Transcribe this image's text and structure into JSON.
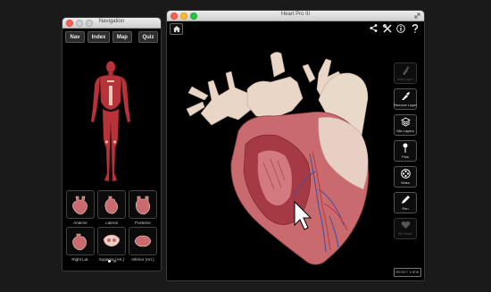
{
  "nav_window": {
    "title": "Navigation",
    "tabs": [
      "Nav",
      "Index",
      "Map",
      "Quiz"
    ],
    "thumbnails": [
      "Anterior",
      "Lateral",
      "Posterior",
      "Right Lat.",
      "Superior (Art.)",
      "Inferior (Art.)"
    ],
    "page_dots": 2
  },
  "main_window": {
    "title": "Heart Pro III",
    "toolbar_icons": [
      "home-icon",
      "share-icon",
      "tools-icon",
      "info-icon",
      "help-icon"
    ],
    "right_tools": [
      {
        "label": "Add Layer",
        "icon": "add-layer-icon",
        "enabled": false
      },
      {
        "label": "Remove Layer",
        "icon": "remove-layer-icon",
        "enabled": true
      },
      {
        "label": "Mix Layers",
        "icon": "layers-icon",
        "enabled": true
      },
      {
        "label": "Pins",
        "icon": "pin-icon",
        "enabled": true
      },
      {
        "label": "Video",
        "icon": "video-icon",
        "enabled": true
      },
      {
        "label": "Pen",
        "icon": "pen-icon",
        "enabled": true
      },
      {
        "label": "3D Heart",
        "icon": "heart-icon",
        "enabled": false
      }
    ],
    "reset_label": "RESET VIEW"
  },
  "colors": {
    "muscle": "#b8323a",
    "heart_tissue": "#c96a6f",
    "vessel": "#e9d2c2",
    "window_bg": "#000000"
  }
}
